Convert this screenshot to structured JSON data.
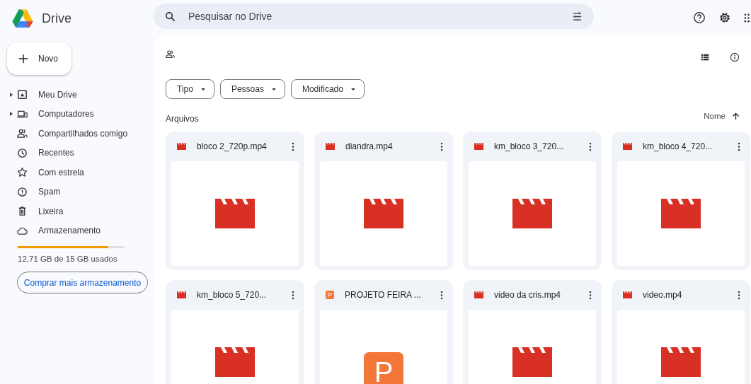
{
  "app": {
    "name": "Drive"
  },
  "new_button": {
    "label": "Novo"
  },
  "sidebar": {
    "items": [
      {
        "kind": "drive",
        "label": "Meu Drive",
        "expandable": true
      },
      {
        "kind": "computer",
        "label": "Computadores",
        "expandable": true
      },
      {
        "kind": "shared",
        "label": "Compartilhados comigo",
        "expandable": false
      },
      {
        "kind": "recent",
        "label": "Recentes",
        "expandable": false
      },
      {
        "kind": "star",
        "label": "Com estrela",
        "expandable": false
      },
      {
        "kind": "spam",
        "label": "Spam",
        "expandable": false
      },
      {
        "kind": "trash",
        "label": "Lixeira",
        "expandable": false
      },
      {
        "kind": "cloud",
        "label": "Armazenamento",
        "expandable": false
      }
    ]
  },
  "storage": {
    "level": 0.85,
    "text": "12,71 GB de 15 GB usados",
    "button": "Comprar mais armazenamento"
  },
  "search": {
    "placeholder": "Pesquisar no Drive"
  },
  "filters": [
    "Tipo",
    "Pessoas",
    "Modificado"
  ],
  "section_title": "Arquivos",
  "sort": {
    "label": "Nome"
  },
  "files": [
    {
      "kind": "video",
      "name": "bloco 2_720p.mp4"
    },
    {
      "kind": "video",
      "name": "diandra.mp4"
    },
    {
      "kind": "video",
      "name": "km_bloco 3_720..."
    },
    {
      "kind": "video",
      "name": "km_bloco 4_720..."
    },
    {
      "kind": "video",
      "name": "km_bloco 5_720..."
    },
    {
      "kind": "slides",
      "name": "PROJETO FEIRA ...",
      "badge": "P",
      "preview_letter": "P"
    },
    {
      "kind": "video",
      "name": "video da cris.mp4"
    },
    {
      "kind": "video",
      "name": "video.mp4"
    }
  ]
}
